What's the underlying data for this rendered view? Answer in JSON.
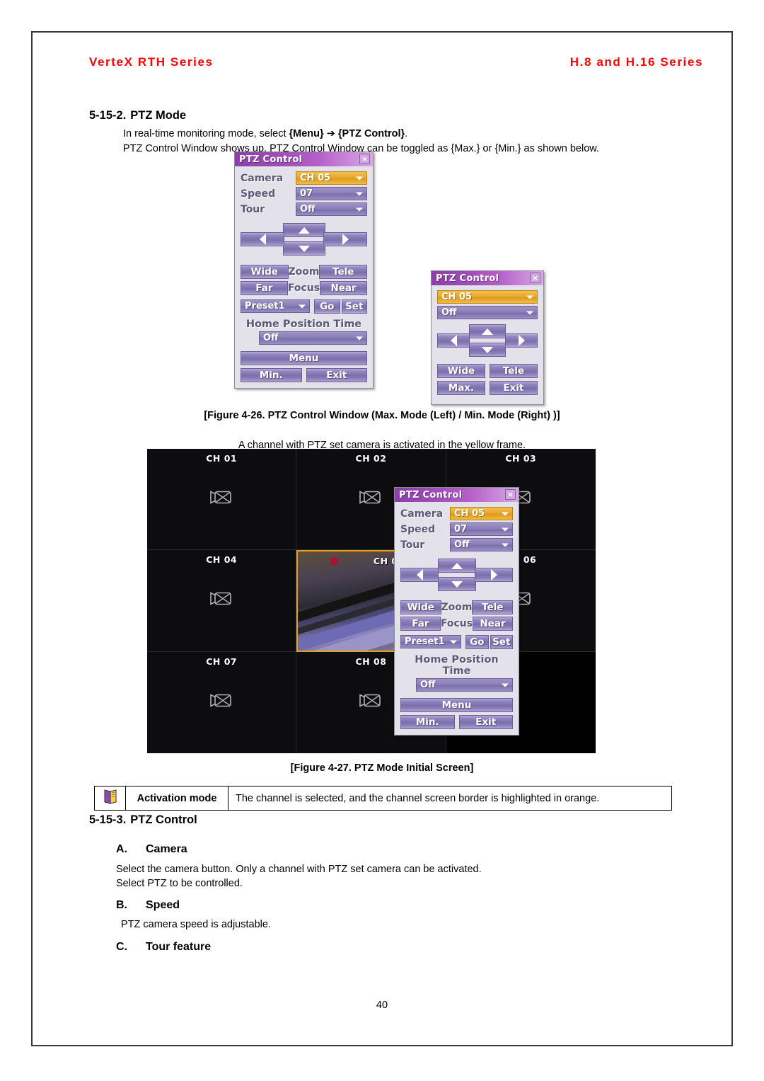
{
  "header": {
    "left": "VerteX RTH Series",
    "right": "H.8 and H.16 Series",
    "color": "#ff0000"
  },
  "sections": {
    "ptz_mode": {
      "num": "5-15-2.",
      "title": "PTZ Mode"
    },
    "ptz_control": {
      "num": "5-15-3.",
      "title": "PTZ Control"
    }
  },
  "body": {
    "line1": "In real-time monitoring mode, select {Menu} ➔ {PTZ Control}.",
    "line1_plain_a": "In real-time monitoring mode, select ",
    "line1_bold_menu": "{Menu}",
    "line1_arrow": " ➔ ",
    "line1_bold_ptz": "{PTZ Control}",
    "line1_end": ".",
    "line2": "PTZ Control Window shows up. PTZ Control Window can be toggled as {Max.} or {Min.} as shown below.",
    "yellow_frame_note": "A channel with PTZ set camera is activated in the yellow frame.",
    "camera_desc_1": "Select the camera button. Only a channel with PTZ set camera can be activated.",
    "camera_desc_2": "Select PTZ to be controlled.",
    "speed_desc": "PTZ camera speed is adjustable."
  },
  "figures": {
    "fig_4_26": "[Figure 4-26. PTZ Control Window (Max. Mode (Left) / Min. Mode (Right) )]",
    "fig_4_27": "[Figure 4-27. PTZ Mode Initial Screen]"
  },
  "note": {
    "icon": "book-note-icon",
    "title": "Activation mode",
    "description": "The channel is selected, and the channel screen border is highlighted in orange."
  },
  "subheadings": [
    {
      "letter": "A.",
      "title": "Camera"
    },
    {
      "letter": "B.",
      "title": "Speed"
    },
    {
      "letter": "C.",
      "title": "Tour feature"
    }
  ],
  "ptz_max": {
    "title": "PTZ Control",
    "close": "×",
    "rows": [
      {
        "label": "Camera",
        "value": "CH 05",
        "highlight": true
      },
      {
        "label": "Speed",
        "value": "07",
        "highlight": false
      },
      {
        "label": "Tour",
        "value": "Off",
        "highlight": false
      }
    ],
    "zoom_label": "Zoom",
    "focus_label": "Focus",
    "wide": "Wide",
    "tele": "Tele",
    "far": "Far",
    "near": "Near",
    "preset": "Preset1",
    "go": "Go",
    "set": "Set",
    "home_position_time_label": "Home Position Time",
    "home_position_time_value": "Off",
    "menu": "Menu",
    "min": "Min.",
    "exit": "Exit"
  },
  "ptz_min": {
    "title": "PTZ Control",
    "close": "×",
    "camera_value": "CH 05",
    "tour_value": "Off",
    "wide": "Wide",
    "tele": "Tele",
    "max": "Max.",
    "exit": "Exit"
  },
  "monitor": {
    "channels": [
      {
        "label": "CH 01",
        "active": false,
        "blank": false
      },
      {
        "label": "CH 02",
        "active": false,
        "blank": false
      },
      {
        "label": "CH 03",
        "active": false,
        "blank": false
      },
      {
        "label": "CH 04",
        "active": false,
        "blank": false
      },
      {
        "label": "CH 05",
        "active": true,
        "blank": false
      },
      {
        "label": "CH 06",
        "active": false,
        "blank": false
      },
      {
        "label": "CH 07",
        "active": false,
        "blank": false
      },
      {
        "label": "CH 08",
        "active": false,
        "blank": false
      },
      {
        "label": "",
        "active": false,
        "blank": true
      }
    ],
    "active_border_color": "#e8a020",
    "camera_icon": "video-camera-icon"
  },
  "footer": {
    "page_number": "40"
  }
}
